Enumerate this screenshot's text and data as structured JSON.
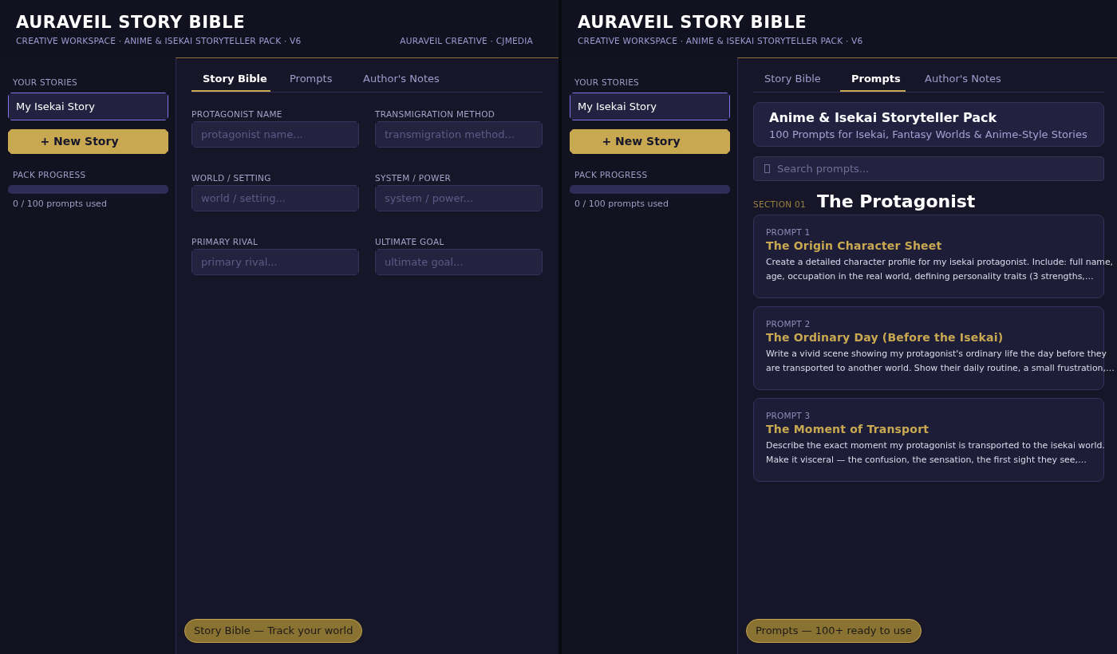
{
  "screens": [
    {
      "header": {
        "title": "AURAVEIL STORY BIBLE",
        "subtitle": "CREATIVE WORKSPACE · ANIME & ISEKAI STORYTELLER PACK · V6",
        "credit": "AURAVEIL CREATIVE · CJMEDIA"
      },
      "sidebar": {
        "stories_label": "YOUR STORIES",
        "stories": [
          {
            "name": "My Isekai Story",
            "selected": true
          }
        ],
        "new_story_button": "+ New Story",
        "progress_label": "PACK PROGRESS",
        "progress": {
          "level": 0
        },
        "progress_text": "0 / 100 prompts used"
      },
      "tabs": [
        {
          "label": "Story Bible",
          "selected": true
        },
        {
          "label": "Prompts",
          "selected": false
        },
        {
          "label": "Author's Notes",
          "selected": false
        }
      ],
      "view": {
        "kind": "story_bible",
        "fields": [
          {
            "label": "PROTAGONIST NAME",
            "placeholder": "protagonist name..."
          },
          {
            "label": "TRANSMIGRATION METHOD",
            "placeholder": "transmigration method..."
          },
          {
            "label": "WORLD / SETTING",
            "placeholder": "world / setting..."
          },
          {
            "label": "SYSTEM / POWER",
            "placeholder": "system / power..."
          },
          {
            "label": "PRIMARY RIVAL",
            "placeholder": "primary rival..."
          },
          {
            "label": "ULTIMATE GOAL",
            "placeholder": "ultimate goal..."
          }
        ]
      },
      "footer_badge": "Story Bible — Track your world"
    },
    {
      "header": {
        "title": "AURAVEIL STORY BIBLE",
        "subtitle": "CREATIVE WORKSPACE · ANIME & ISEKAI STORYTELLER PACK · V6"
      },
      "sidebar": {
        "stories_label": "YOUR STORIES",
        "stories": [
          {
            "name": "My Isekai Story",
            "selected": true
          }
        ],
        "new_story_button": "+ New Story",
        "progress_label": "PACK PROGRESS",
        "progress": {
          "level": 0
        },
        "progress_text": "0 / 100 prompts used"
      },
      "tabs": [
        {
          "label": "Story Bible",
          "selected": false
        },
        {
          "label": "Prompts",
          "selected": true
        },
        {
          "label": "Author's Notes",
          "selected": false
        }
      ],
      "view": {
        "kind": "prompts",
        "pack": {
          "title": "Anime & Isekai Storyteller Pack",
          "subtitle": "100 Prompts for Isekai, Fantasy Worlds & Anime-Style Stories"
        },
        "search": {
          "placeholder": "Search prompts..."
        },
        "section": {
          "number": "SECTION 01",
          "title": "The Protagonist"
        },
        "prompts": [
          {
            "label": "PROMPT 1",
            "title": "The Origin Character Sheet",
            "body": "Create a detailed character profile for my isekai protagonist. Include: full name, age, occupation in the real world, defining personality traits (3 strengths,…"
          },
          {
            "label": "PROMPT 2",
            "title": "The Ordinary Day (Before the Isekai)",
            "body": "Write a vivid scene showing my protagonist's ordinary life the day before they are transported to another world. Show their daily routine, a small frustration,…"
          },
          {
            "label": "PROMPT 3",
            "title": "The Moment of Transport",
            "body": "Describe the exact moment my protagonist is transported to the isekai world. Make it visceral — the confusion, the sensation, the first sight they see,…"
          }
        ]
      },
      "footer_badge": "Prompts — 100+ ready to use"
    }
  ]
}
